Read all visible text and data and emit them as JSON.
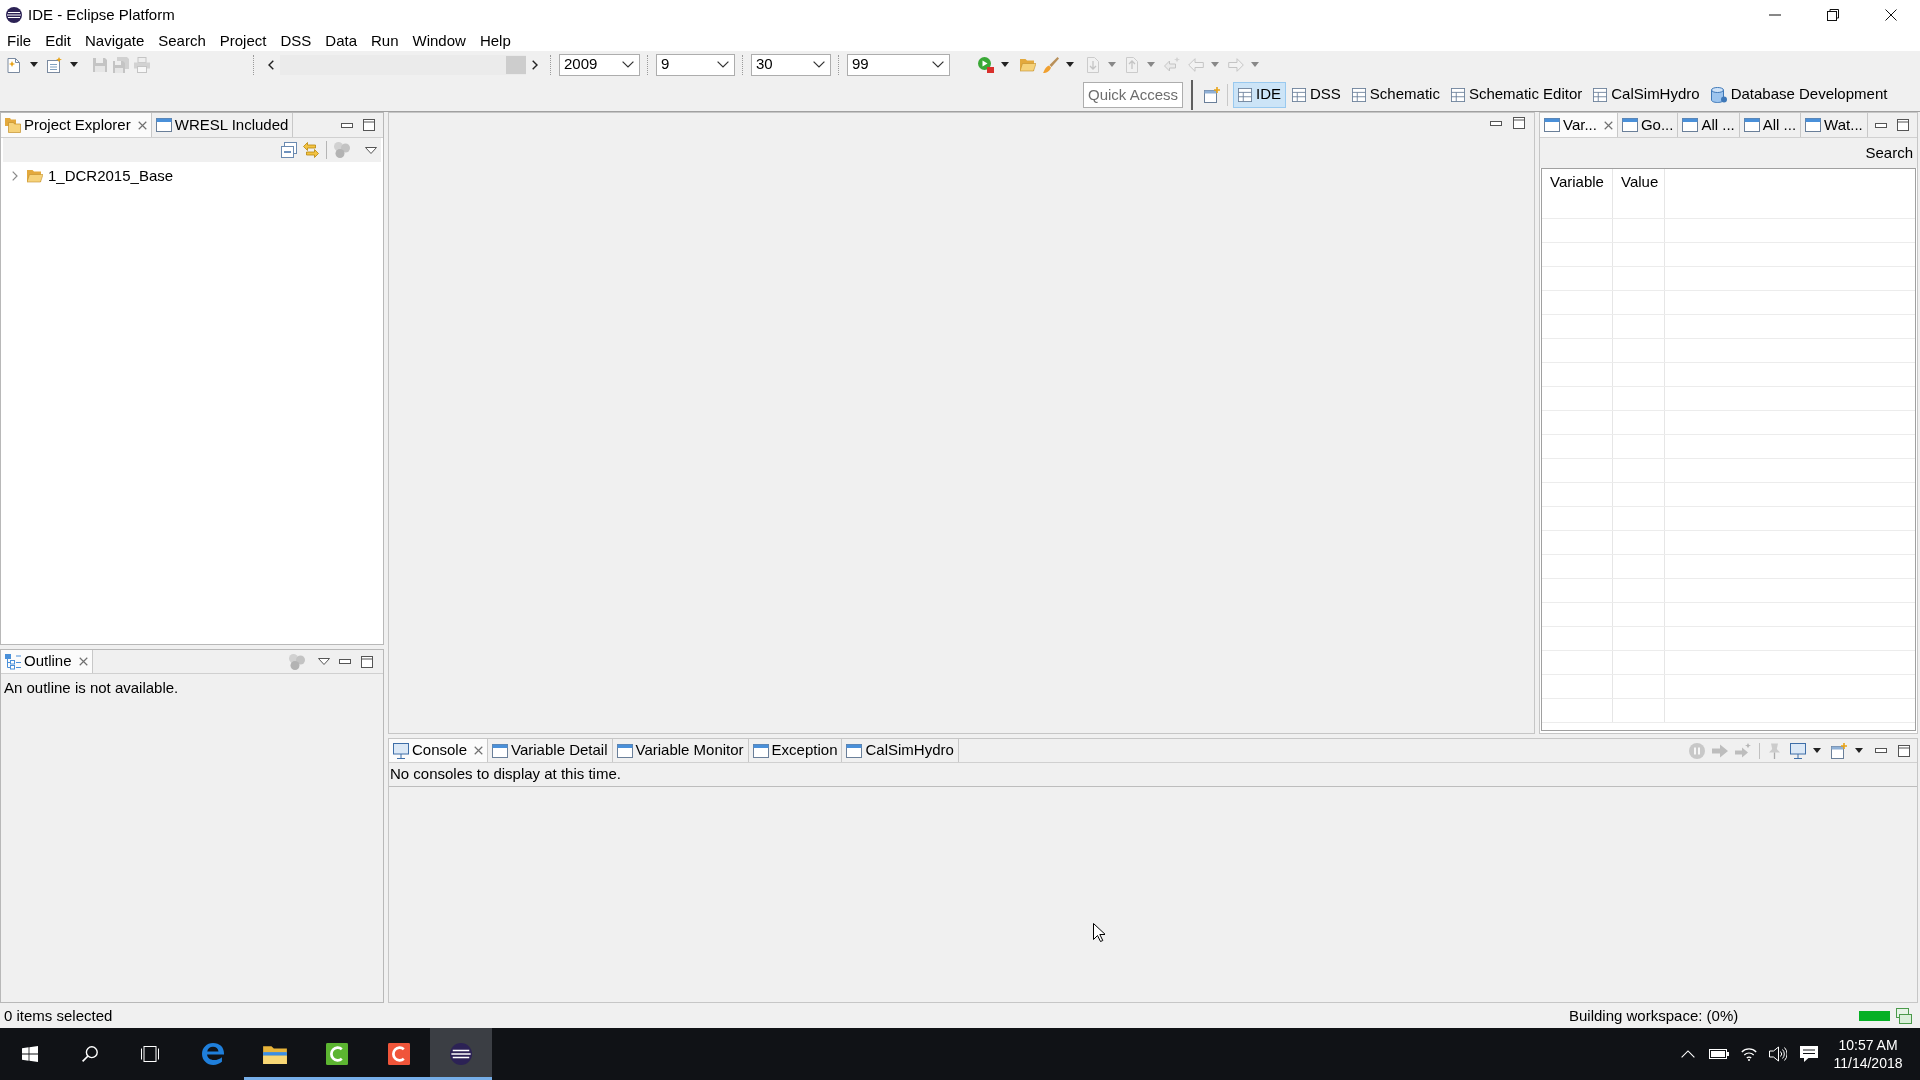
{
  "window": {
    "title": "IDE - Eclipse Platform"
  },
  "menu_bar": [
    "File",
    "Edit",
    "Navigate",
    "Search",
    "Project",
    "DSS",
    "Data",
    "Run",
    "Window",
    "Help"
  ],
  "main_toolbar": {
    "left_buttons": [
      {
        "disabled": false
      },
      {
        "disabled": false
      },
      {
        "disabled": true
      },
      {
        "disabled": true
      },
      {
        "disabled": true
      }
    ],
    "slider": {
      "level": 1
    },
    "date_selectors": [
      {
        "value": "2009"
      },
      {
        "value": "9"
      },
      {
        "value": "30"
      },
      {
        "value": "99"
      }
    ],
    "right_buttons": [
      {
        "disabled": false
      },
      {
        "disabled": false
      },
      {
        "disabled": false
      },
      {
        "disabled": true
      },
      {
        "disabled": true
      },
      {
        "disabled": true
      },
      {
        "disabled": true
      },
      {
        "disabled": true
      }
    ]
  },
  "quick_access": {
    "placeholder": "Quick Access"
  },
  "perspectives": [
    {
      "label": "IDE",
      "selected": true
    },
    {
      "label": "DSS",
      "selected": false
    },
    {
      "label": "Schematic",
      "selected": false
    },
    {
      "label": "Schematic Editor",
      "selected": false
    },
    {
      "label": "CalSimHydro",
      "selected": false
    },
    {
      "label": "Database Development",
      "selected": false
    }
  ],
  "project_explorer": {
    "tabs": [
      {
        "label": "Project Explorer",
        "selected": true
      },
      {
        "label": "WRESL Included",
        "selected": false
      }
    ],
    "tree": [
      {
        "label": "1_DCR2015_Base",
        "expanded": false
      }
    ]
  },
  "outline": {
    "tabs": [
      {
        "label": "Outline",
        "selected": true
      }
    ],
    "message": "An outline is not available."
  },
  "variables_view": {
    "tabs": [
      {
        "label": "Var...",
        "selected": true
      },
      {
        "label": "Go...",
        "selected": false
      },
      {
        "label": "All ...",
        "selected": false
      },
      {
        "label": "All ...",
        "selected": false
      },
      {
        "label": "Wat...",
        "selected": false
      }
    ],
    "search_button": "Search",
    "table": {
      "columns": [
        "Variable",
        "Value"
      ]
    }
  },
  "console_view": {
    "tabs": [
      {
        "label": "Console",
        "selected": true
      },
      {
        "label": "Variable Detail",
        "selected": false
      },
      {
        "label": "Variable Monitor",
        "selected": false
      },
      {
        "label": "Exception",
        "selected": false
      },
      {
        "label": "CalSimHydro",
        "selected": false
      }
    ],
    "message": "No consoles to display at this time."
  },
  "status_bar": {
    "selection": "0 items selected",
    "job": "Building workspace: (0%)",
    "progress": {
      "level": 1
    }
  },
  "taskbar": {
    "apps": [
      {
        "running": false,
        "selected": false
      },
      {
        "running": true,
        "selected": false
      },
      {
        "running": true,
        "selected": false
      },
      {
        "running": true,
        "selected": false
      },
      {
        "running": true,
        "selected": true
      }
    ],
    "clock": {
      "time": "10:57 AM",
      "date": "11/14/2018"
    }
  }
}
